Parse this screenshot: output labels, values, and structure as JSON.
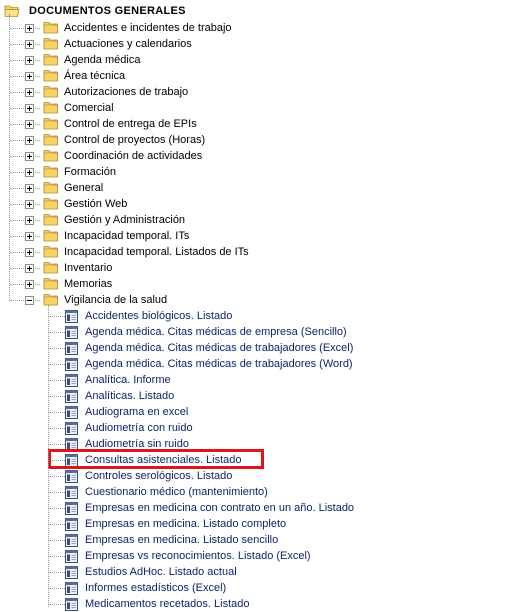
{
  "tree": {
    "root_label": "DOCUMENTOS GENERALES",
    "folders": [
      {
        "label": "Accidentes e incidentes de trabajo",
        "expanded": false
      },
      {
        "label": "Actuaciones y calendarios",
        "expanded": false
      },
      {
        "label": "Agenda médica",
        "expanded": false
      },
      {
        "label": "Área técnica",
        "expanded": false
      },
      {
        "label": "Autorizaciones de trabajo",
        "expanded": false
      },
      {
        "label": "Comercial",
        "expanded": false
      },
      {
        "label": "Control de entrega de EPIs",
        "expanded": false
      },
      {
        "label": "Control de proyectos (Horas)",
        "expanded": false
      },
      {
        "label": "Coordinación de actividades",
        "expanded": false
      },
      {
        "label": "Formación",
        "expanded": false
      },
      {
        "label": "General",
        "expanded": false
      },
      {
        "label": "Gestión Web",
        "expanded": false
      },
      {
        "label": "Gestión y Administración",
        "expanded": false
      },
      {
        "label": "Incapacidad temporal. ITs",
        "expanded": false
      },
      {
        "label": "Incapacidad temporal. Listados de ITs",
        "expanded": false
      },
      {
        "label": "Inventario",
        "expanded": false
      },
      {
        "label": "Memorias",
        "expanded": false
      },
      {
        "label": "Vigilancia de la salud",
        "expanded": true
      }
    ],
    "reports": [
      {
        "label": "Accidentes biológicos. Listado",
        "highlighted": false
      },
      {
        "label": "Agenda médica. Citas médicas de empresa (Sencillo)",
        "highlighted": false
      },
      {
        "label": "Agenda médica. Citas médicas de trabajadores (Excel)",
        "highlighted": false
      },
      {
        "label": "Agenda médica. Citas médicas de trabajadores (Word)",
        "highlighted": false
      },
      {
        "label": "Analítica. Informe",
        "highlighted": false
      },
      {
        "label": "Analíticas. Listado",
        "highlighted": false
      },
      {
        "label": "Audiograma en excel",
        "highlighted": false
      },
      {
        "label": "Audiometría con ruido",
        "highlighted": false
      },
      {
        "label": "Audiometría sin ruido",
        "highlighted": false
      },
      {
        "label": "Consultas asistenciales. Listado",
        "highlighted": true
      },
      {
        "label": "Controles serológicos. Listado",
        "highlighted": false
      },
      {
        "label": "Cuestionario médico (mantenimiento)",
        "highlighted": false
      },
      {
        "label": "Empresas en medicina con contrato en un año. Listado",
        "highlighted": false
      },
      {
        "label": "Empresas en medicina. Listado completo",
        "highlighted": false
      },
      {
        "label": "Empresas en medicina. Listado sencillo",
        "highlighted": false
      },
      {
        "label": "Empresas vs reconocimientos. Listado  (Excel)",
        "highlighted": false
      },
      {
        "label": "Estudios AdHoc. Listado actual",
        "highlighted": false
      },
      {
        "label": "Informes estadísticos (Excel)",
        "highlighted": false
      },
      {
        "label": "Medicamentos recetados. Listado",
        "highlighted": false
      }
    ]
  },
  "colors": {
    "folder_fill": "#f7d26a",
    "folder_border": "#b48a1e",
    "report_text": "#10226e",
    "highlight_border": "#e0151c"
  }
}
